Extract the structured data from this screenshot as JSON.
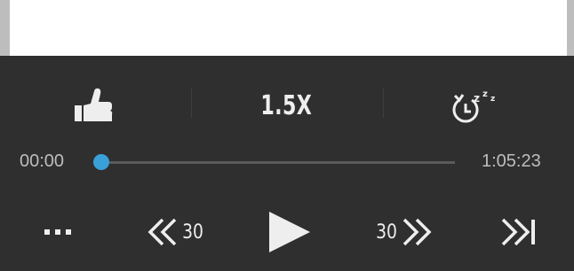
{
  "player": {
    "speed_label": "1.5X",
    "current_time": "00:00",
    "total_time": "1:05:23",
    "progress": 0,
    "rewind_seconds": "30",
    "forward_seconds": "30",
    "colors": {
      "background": "#2f2f2f",
      "accent": "#3aa0d8",
      "icon": "#eeeeee",
      "time_text": "#bdbdbd"
    },
    "icons": {
      "like": "thumbs-up-icon",
      "sleep_timer": "sleep-timer-icon",
      "more": "more-icon",
      "rewind": "rewind-icon",
      "play": "play-icon",
      "forward": "fast-forward-icon",
      "next": "skip-next-icon"
    }
  }
}
